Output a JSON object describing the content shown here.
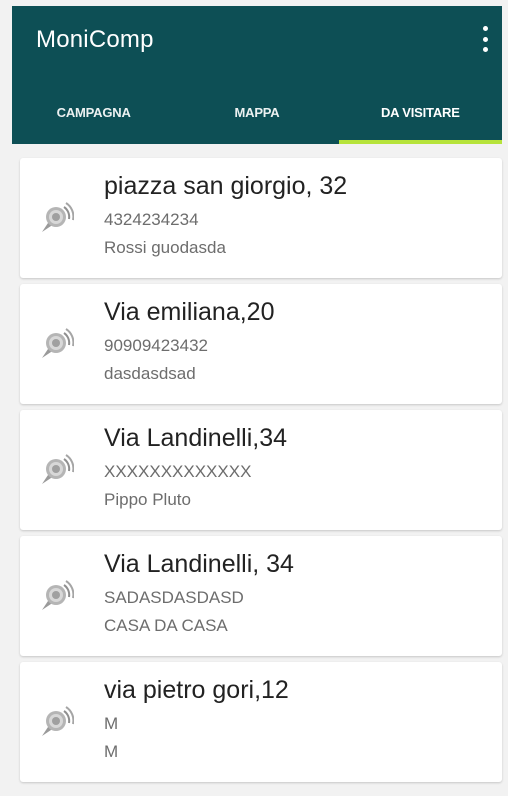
{
  "app": {
    "title": "MoniComp",
    "primary_color": "#0d4f55",
    "indicator_color": "#b6e33b"
  },
  "tabs": [
    {
      "label": "CAMPAGNA"
    },
    {
      "label": "MAPPA"
    },
    {
      "label": "DA VISITARE",
      "active": true
    }
  ],
  "items": [
    {
      "address": "piazza san giorgio, 32",
      "code": "4324234234",
      "name": "Rossi guodasda",
      "icon": "satellite-dish-icon"
    },
    {
      "address": "Via emiliana,20",
      "code": "90909423432",
      "name": "dasdasdsad",
      "icon": "satellite-dish-icon"
    },
    {
      "address": "Via Landinelli,34",
      "code": "XXXXXXXXXXXXX",
      "name": "Pippo Pluto",
      "icon": "satellite-dish-icon"
    },
    {
      "address": "Via Landinelli, 34",
      "code": "SADASDASDASD",
      "name": "CASA DA CASA",
      "icon": "satellite-dish-icon"
    },
    {
      "address": "via pietro gori,12",
      "code": "M",
      "name": "M",
      "icon": "satellite-dish-icon"
    }
  ]
}
